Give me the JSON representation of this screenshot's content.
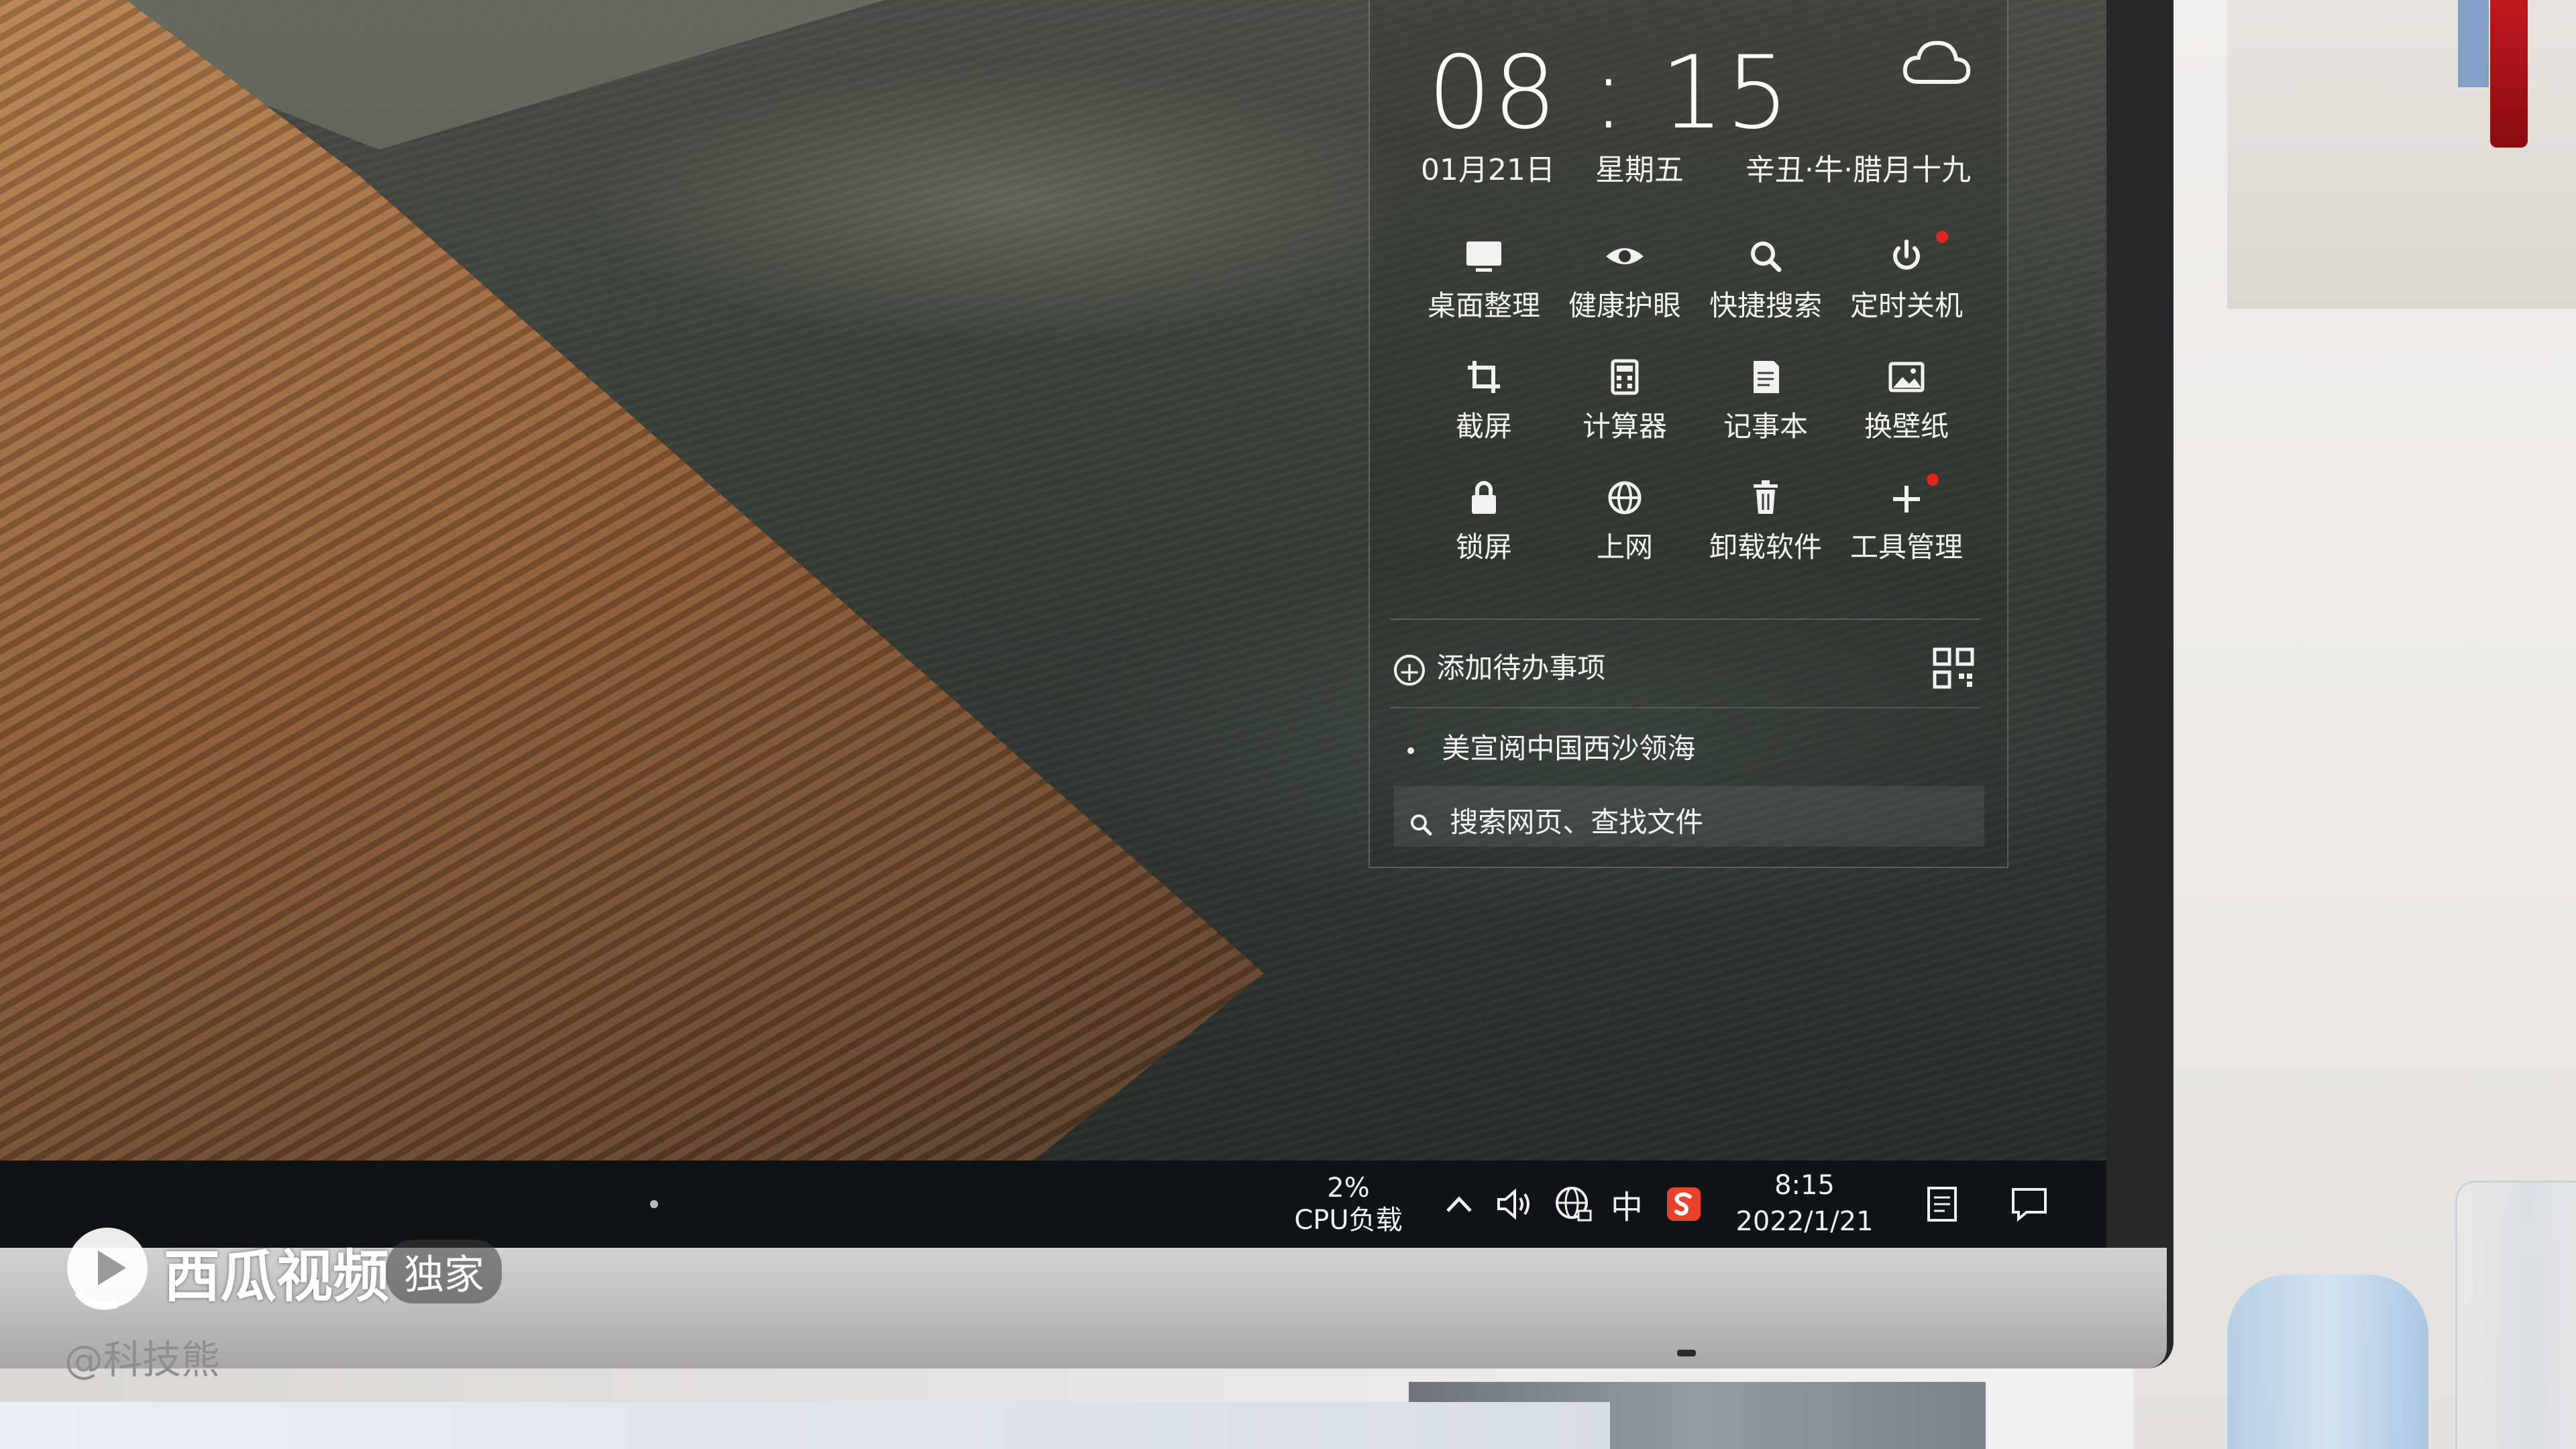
{
  "widget": {
    "time": "08 : 15",
    "weather_icon": "cloud-icon",
    "date": "01月21日",
    "weekday": "星期五",
    "lunar_date": "辛丑·牛·腊月十九",
    "tools": [
      {
        "label": "桌面整理",
        "icon": "desktop-icon"
      },
      {
        "label": "健康护眼",
        "icon": "eye-icon"
      },
      {
        "label": "快捷搜索",
        "icon": "search-icon"
      },
      {
        "label": "定时关机",
        "icon": "power-icon"
      },
      {
        "label": "截屏",
        "icon": "crop-icon"
      },
      {
        "label": "计算器",
        "icon": "calculator-icon"
      },
      {
        "label": "记事本",
        "icon": "notepad-icon"
      },
      {
        "label": "换壁纸",
        "icon": "wallpaper-icon"
      },
      {
        "label": "锁屏",
        "icon": "lock-icon"
      },
      {
        "label": "上网",
        "icon": "globe-icon"
      },
      {
        "label": "卸载软件",
        "icon": "trash-icon"
      },
      {
        "label": "工具管理",
        "icon": "plus-icon"
      }
    ],
    "add_todo": "添加待办事项",
    "news_item": "美宣阅中国西沙领海",
    "search_placeholder": "搜索网页、查找文件"
  },
  "taskbar": {
    "cpu_percent": "2%",
    "cpu_label": "CPU负载",
    "ime_label": "中",
    "time": "8:15",
    "date": "2022/1/21"
  },
  "watermark": {
    "app_name": "西瓜视频",
    "badge": "独家",
    "author": "@科技熊"
  },
  "colors": {
    "taskbar_bg": "#101416",
    "notification_dot": "#e3231d",
    "sogou_ime": "#e8412c"
  }
}
